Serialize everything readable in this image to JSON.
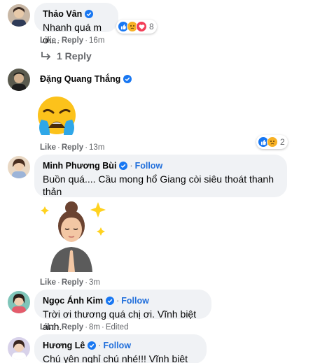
{
  "colors": {
    "bubble": "#f0f2f5",
    "follow": "#216fdb",
    "verified": "#1877f2",
    "muted": "#65676b"
  },
  "actions": {
    "like": "Like",
    "reply": "Reply",
    "sep": "·",
    "follow": "Follow",
    "edited": "Edited"
  },
  "comments": [
    {
      "name": "Thảo Vân",
      "text": "Nhanh quá m ơi...",
      "time": "16m",
      "reactions": [
        "like",
        "sad",
        "love"
      ],
      "reaction_count": "8"
    },
    {
      "name": "Đặng Quang Thắng",
      "sticker": "crying-emoji",
      "time": "13m",
      "reactions": [
        "like",
        "sad"
      ],
      "reaction_count": "2"
    },
    {
      "name": "Minh Phương Bùi",
      "text": "Buồn quá.... Cầu mong hổ Giang còi siêu thoát thanh thản",
      "sticker": "praying-memoji",
      "time": "3m"
    },
    {
      "name": "Ngọc Ánh Kim",
      "text": "Trời ơi thương quá chị ơi. Vĩnh biệt anh.",
      "time": "8m",
      "edited": true
    },
    {
      "name": "Hương Lê",
      "text": "Chú yên nghỉ chú nhé!!! Vĩnh biệt chú"
    }
  ],
  "replies": {
    "label": "1 Reply"
  }
}
